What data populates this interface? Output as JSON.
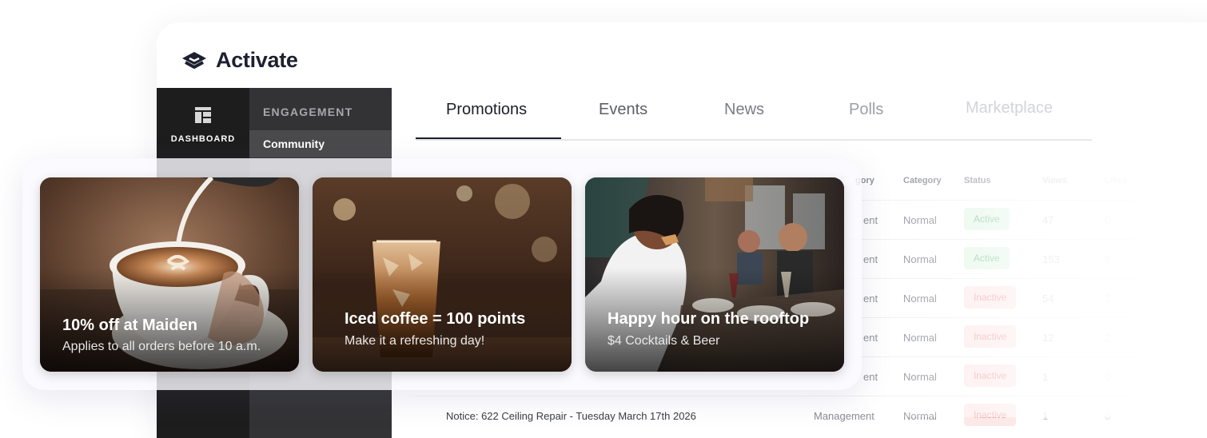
{
  "app": {
    "brand_name": "Activate"
  },
  "rail": {
    "dashboard_label": "DASHBOARD"
  },
  "subnav": {
    "heading": "ENGAGEMENT",
    "active_item": "Community"
  },
  "tabs": [
    {
      "label": "Promotions",
      "active": true
    },
    {
      "label": "Events"
    },
    {
      "label": "News"
    },
    {
      "label": "Polls"
    },
    {
      "label": "Marketplace"
    }
  ],
  "table": {
    "headers": {
      "subcategory_partial": "gory",
      "category": "Category",
      "status": "Status",
      "views": "Views",
      "likes": "Likes"
    },
    "rows": [
      {
        "subcategory": "ent",
        "category": "Normal",
        "status": "Active",
        "views": "47",
        "likes": "0"
      },
      {
        "subcategory": "ent",
        "category": "Normal",
        "status": "Active",
        "views": "153",
        "likes": "8"
      },
      {
        "subcategory": "ent",
        "category": "Normal",
        "status": "Inactive",
        "views": "54",
        "likes": "3"
      },
      {
        "subcategory": "ent",
        "category": "Normal",
        "status": "Inactive",
        "views": "12",
        "likes": "2"
      },
      {
        "subcategory": "ent",
        "category": "Normal",
        "status": "Inactive",
        "views": "1",
        "likes": "0"
      },
      {
        "title": "Notice: 622 Ceiling Repair - Tuesday March 17th 2026",
        "subcategory": "Management",
        "category": "Normal",
        "status": "Inactive",
        "views": "1",
        "likes": "0"
      }
    ]
  },
  "cards": [
    {
      "title": "10% off at Maiden",
      "subtitle": "Applies to all orders before 10 a.m.",
      "icon": "latte-photo"
    },
    {
      "title": "Iced coffee = 100 points",
      "subtitle": "Make it a refreshing day!",
      "icon": "iced-coffee-photo"
    },
    {
      "title": "Happy hour on the rooftop",
      "subtitle": "$4 Cocktails & Beer",
      "icon": "restaurant-photo"
    }
  ],
  "colors": {
    "rail_bg": "#1d1d1d",
    "subnav_bg": "#333335",
    "active_badge": "#e3f6e7",
    "inactive_badge": "#fde8e8"
  }
}
